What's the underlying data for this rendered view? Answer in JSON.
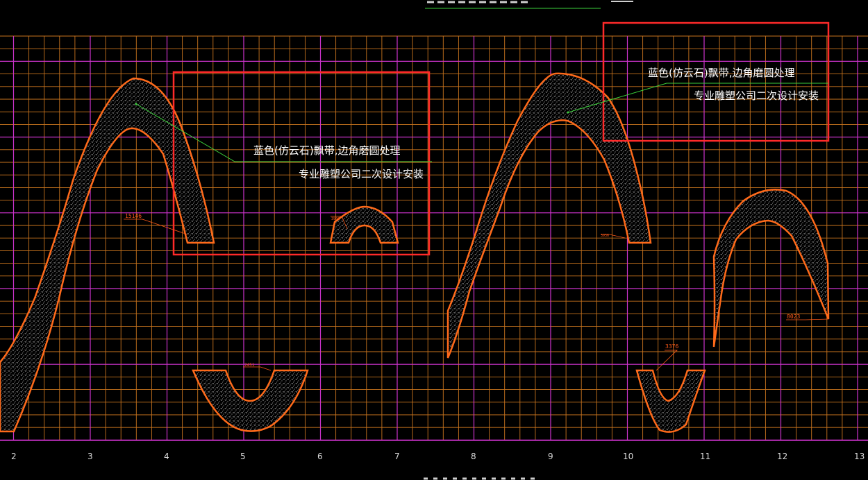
{
  "colors": {
    "background": "#000000",
    "grid_minor": "#c8741e",
    "grid_major": "#cc33cc",
    "shape_outline": "#ff6a1a",
    "shape_hatch": "#bfbfbf",
    "highlight_box": "#ff2a2a",
    "leader_line": "#3bd13b",
    "annotation_text": "#ffffff"
  },
  "annotations": [
    {
      "line1": "蓝色(仿云石)飘带,边角磨圆处理",
      "line2": "专业雕塑公司二次设计安装"
    },
    {
      "line1": "蓝色(仿云石)飘带,边角磨圆处理",
      "line2": "专业雕塑公司二次设计安装"
    }
  ],
  "dimensions": {
    "ribbon_a": "15146",
    "arch_small": "3966",
    "cup_left": "2451",
    "ribbon_b": "3936",
    "cup_right": "3376",
    "arch_right": "8023"
  },
  "axis_labels": [
    "2",
    "3",
    "4",
    "5",
    "6",
    "7",
    "8",
    "9",
    "10",
    "11",
    "12",
    "13"
  ]
}
